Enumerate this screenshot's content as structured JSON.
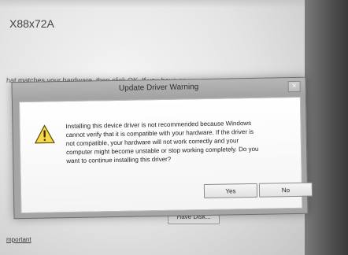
{
  "background": {
    "hardware_id": "X88x72A",
    "instruction_partial": "hat matches your hardware, then click OK. If you have an",
    "have_disk_label": "Have Disk...",
    "link_partial": "mportant"
  },
  "dialog": {
    "title": "Update Driver Warning",
    "close_glyph": "×",
    "message_lines": [
      "Installing this device driver is not recommended because Windows",
      "cannot verify that it is compatible with your hardware.  If the driver is",
      "not compatible, your hardware will not work correctly and your",
      "computer might become unstable or stop working completely.  Do you",
      "want to continue installing this driver?"
    ],
    "yes_label": "Yes",
    "no_label": "No"
  },
  "colors": {
    "warning_yellow": "#f6d94a",
    "warning_outline": "#5a4b08"
  },
  "icons": {
    "warning": "warning-icon",
    "close": "close-icon"
  }
}
